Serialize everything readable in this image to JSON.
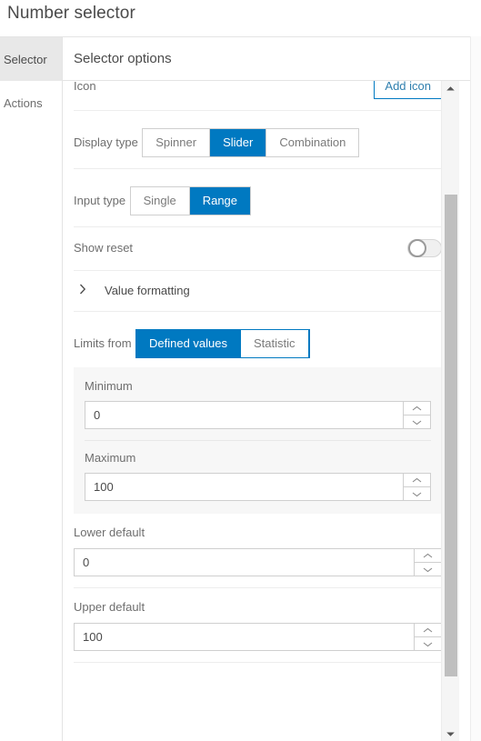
{
  "window": {
    "title": "Number selector"
  },
  "side_tabs": [
    {
      "label": "Selector",
      "active": true
    },
    {
      "label": "Actions",
      "active": false
    }
  ],
  "content": {
    "header": "Selector options",
    "icon_row": {
      "label": "Icon",
      "button": "Add icon"
    },
    "display_type": {
      "label": "Display type",
      "options": [
        "Spinner",
        "Slider",
        "Combination"
      ],
      "selected": "Slider"
    },
    "input_type": {
      "label": "Input type",
      "options": [
        "Single",
        "Range"
      ],
      "selected": "Range"
    },
    "show_reset": {
      "label": "Show reset",
      "value": "off"
    },
    "value_formatting": {
      "label": "Value formatting",
      "chevron": "chevron-right-icon",
      "expanded": "false"
    },
    "limits_from": {
      "label": "Limits from",
      "options": [
        "Defined values",
        "Statistic"
      ],
      "selected": "Defined values"
    },
    "minimum": {
      "label": "Minimum",
      "value": "0"
    },
    "maximum": {
      "label": "Maximum",
      "value": "100"
    },
    "lower_default": {
      "label": "Lower default",
      "value": "0"
    },
    "upper_default": {
      "label": "Upper default",
      "value": "100"
    }
  },
  "scrollbar": {
    "up_arrow": "scroll-up-icon",
    "down_arrow": "scroll-down-icon"
  },
  "colors": {
    "accent": "#0079c1",
    "link": "#2f7fae",
    "text": "#4a4a4a",
    "muted": "#6e6e6e",
    "panel_bg": "#f7f7f7",
    "tab_active_bg": "#e8e8e8"
  }
}
